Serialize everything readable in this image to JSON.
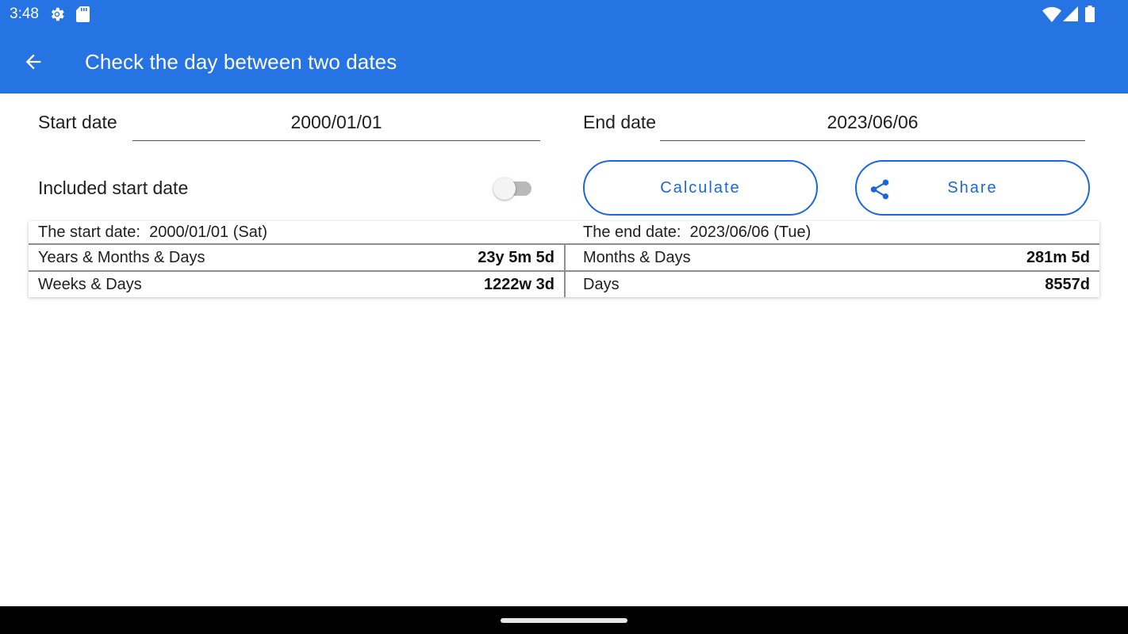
{
  "status_bar": {
    "time": "3:48",
    "icons": [
      "settings-gear-icon",
      "sd-card-icon",
      "wifi-icon",
      "cell-signal-icon",
      "battery-icon"
    ]
  },
  "app_bar": {
    "title": "Check the day between two dates",
    "back_icon": "arrow-left-icon",
    "color": "#2673e3"
  },
  "form": {
    "start_label": "Start date",
    "start_value": "2000/01/01",
    "end_label": "End date",
    "end_value": "2023/06/06",
    "include_start_label": "Included start date",
    "include_start_on": false
  },
  "buttons": {
    "calculate_label": "Calculate",
    "share_label": "Share",
    "share_icon": "share-icon",
    "accent": "#1a67dd"
  },
  "results": {
    "start_label": "The start date:  2000/01/01 (Sat)",
    "end_label": "The end date:  2023/06/06 (Tue)",
    "rows": [
      {
        "left_label": "Years & Months & Days",
        "left_value": "23y 5m 5d",
        "right_label": "Months & Days",
        "right_value": "281m 5d"
      },
      {
        "left_label": "Weeks & Days",
        "left_value": "1222w 3d",
        "right_label": "Days",
        "right_value": "8557d"
      }
    ]
  }
}
